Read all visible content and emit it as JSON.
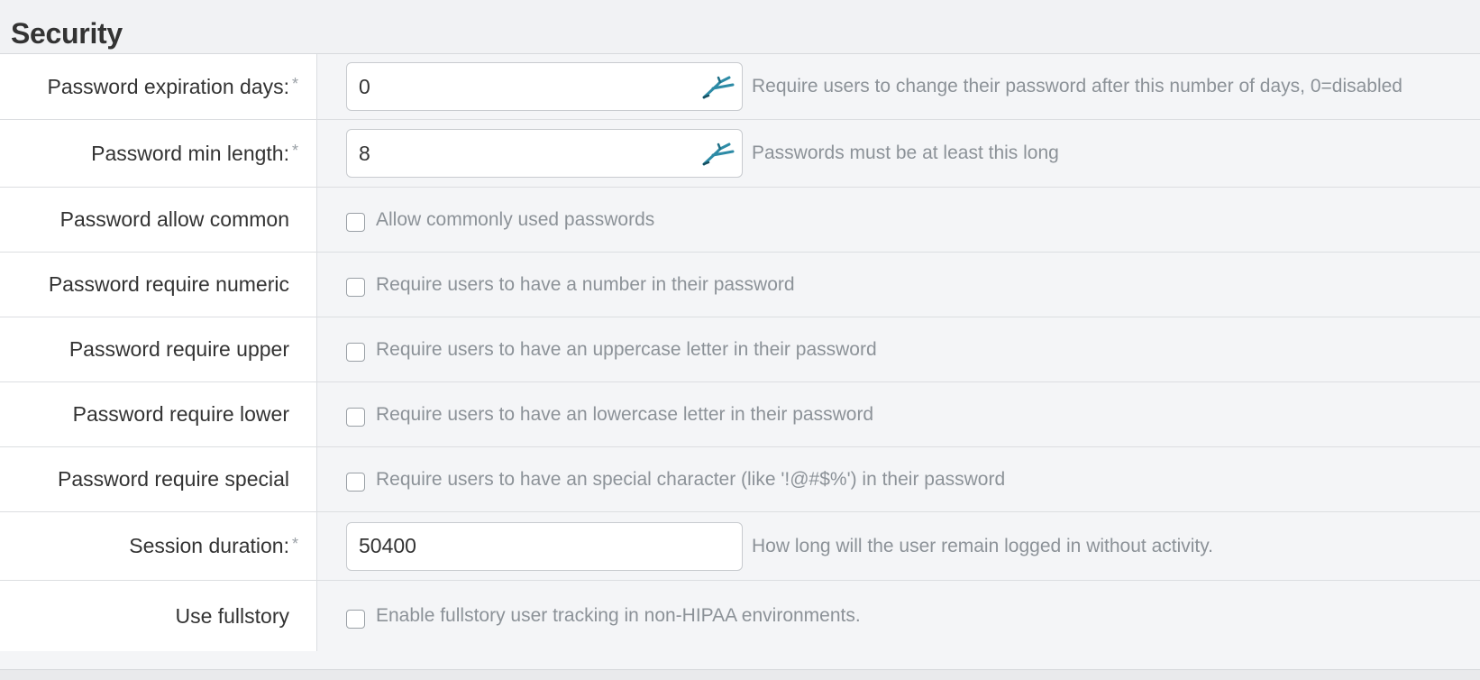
{
  "section": {
    "title": "Security"
  },
  "required_marker": "*",
  "colors": {
    "pen_icon": "#2d8ba6",
    "help_text": "#8c9298"
  },
  "fields": [
    {
      "label": "Password expiration days:",
      "required": true,
      "type": "text",
      "value": "0",
      "has_pen_icon": true,
      "pen_icon": "pen-icon",
      "help": "Require users to change their password after this number of days, 0=disabled"
    },
    {
      "label": "Password min length:",
      "required": true,
      "type": "text",
      "value": "8",
      "has_pen_icon": true,
      "pen_icon": "pen-icon",
      "help": "Passwords must be at least this long"
    },
    {
      "label": "Password allow common",
      "required": false,
      "type": "checkbox",
      "checked": false,
      "help": "Allow commonly used passwords"
    },
    {
      "label": "Password require numeric",
      "required": false,
      "type": "checkbox",
      "checked": false,
      "help": "Require users to have a number in their password"
    },
    {
      "label": "Password require upper",
      "required": false,
      "type": "checkbox",
      "checked": false,
      "help": "Require users to have an uppercase letter in their password"
    },
    {
      "label": "Password require lower",
      "required": false,
      "type": "checkbox",
      "checked": false,
      "help": "Require users to have an lowercase letter in their password"
    },
    {
      "label": "Password require special",
      "required": false,
      "type": "checkbox",
      "checked": false,
      "help": "Require users to have an special character (like '!@#$%') in their password"
    },
    {
      "label": "Session duration:",
      "required": true,
      "type": "text",
      "value": "50400",
      "has_pen_icon": false,
      "help": "How long will the user remain logged in without activity."
    },
    {
      "label": "Use fullstory",
      "required": false,
      "type": "checkbox",
      "checked": false,
      "help": "Enable fullstory user tracking in non-HIPAA environments."
    }
  ]
}
